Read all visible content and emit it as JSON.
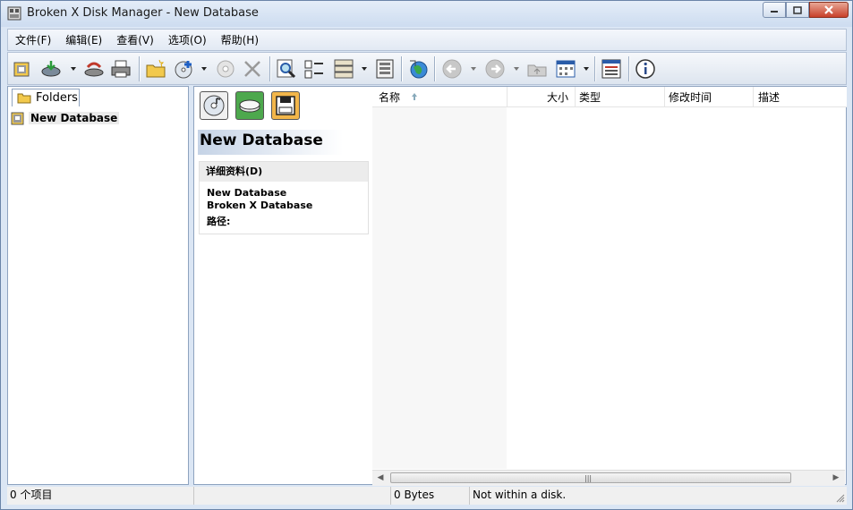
{
  "window": {
    "title": "Broken X Disk Manager - New Database",
    "colors": {
      "frame": "#dbe6f4",
      "accent": "#2a5ca8",
      "header_panel": "#c5d3e6"
    }
  },
  "menu": [
    {
      "label": "文件(F)"
    },
    {
      "label": "编辑(E)"
    },
    {
      "label": "查看(V)"
    },
    {
      "label": "选项(O)"
    },
    {
      "label": "帮助(H)"
    }
  ],
  "toolbar": {
    "icons": [
      "open-database-icon",
      "scan-disk-icon",
      "eject-icon",
      "print-icon",
      "new-folder-icon",
      "add-disk-icon",
      "properties-icon",
      "delete-icon",
      "find-icon",
      "list-view-icon",
      "details-view-icon",
      "item-list-icon",
      "web-globe-icon",
      "back-icon",
      "forward-icon",
      "up-folder-icon",
      "view-mode-icon",
      "report-icon",
      "about-icon"
    ]
  },
  "left_panel": {
    "tab_label": "Folders",
    "tree": [
      {
        "label": "New Database"
      }
    ]
  },
  "middle_panel": {
    "title": "New Database",
    "details_header": "详细资料(D)",
    "details_line1": "New Database",
    "details_line2": "Broken X Database",
    "path_label": "路径:"
  },
  "file_list": {
    "columns": [
      {
        "label": "名称"
      },
      {
        "label": "大小"
      },
      {
        "label": "类型"
      },
      {
        "label": "修改时间"
      },
      {
        "label": "描述"
      }
    ],
    "rows": []
  },
  "statusbar": {
    "count": "0 个项目",
    "size": "0 Bytes",
    "disk": "Not within a disk."
  }
}
